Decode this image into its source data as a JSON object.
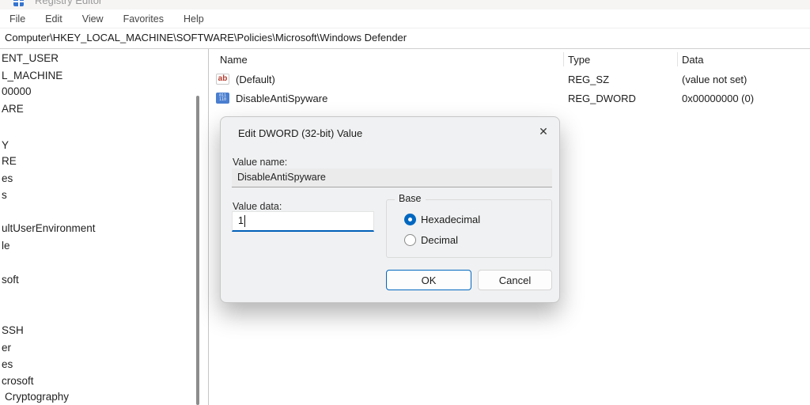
{
  "window": {
    "title": "Registry Editor"
  },
  "menu": {
    "items": [
      "File",
      "Edit",
      "View",
      "Favorites",
      "Help"
    ]
  },
  "address_bar": {
    "path": "Computer\\HKEY_LOCAL_MACHINE\\SOFTWARE\\Policies\\Microsoft\\Windows Defender"
  },
  "tree": {
    "items": [
      "ENT_USER",
      "L_MACHINE",
      "00000",
      "ARE",
      "Y",
      "RE",
      "es",
      "s",
      "ultUserEnvironment",
      "le",
      "soft",
      "SSH",
      "er",
      "es",
      "crosoft",
      "Cryptography"
    ]
  },
  "list": {
    "columns": [
      "Name",
      "Type",
      "Data"
    ],
    "rows": [
      {
        "icon": "string-value-icon",
        "icon_glyph": "ab",
        "name": "(Default)",
        "type": "REG_SZ",
        "data": "(value not set)"
      },
      {
        "icon": "dword-value-icon",
        "icon_line1": "011",
        "icon_line2": "110",
        "name": "DisableAntiSpyware",
        "type": "REG_DWORD",
        "data": "0x00000000 (0)"
      }
    ]
  },
  "dialog": {
    "title": "Edit DWORD (32-bit) Value",
    "close_glyph": "✕",
    "value_name_label": "Value name:",
    "value_name": "DisableAntiSpyware",
    "value_data_label": "Value data:",
    "value_data": "1",
    "base_group_label": "Base",
    "radio_hexadecimal": "Hexadecimal",
    "radio_decimal": "Decimal",
    "ok_label": "OK",
    "cancel_label": "Cancel"
  },
  "colors": {
    "accent": "#0067c0",
    "focus_underline": "#005fb8",
    "dialog_bg": "#f0f1f2"
  }
}
